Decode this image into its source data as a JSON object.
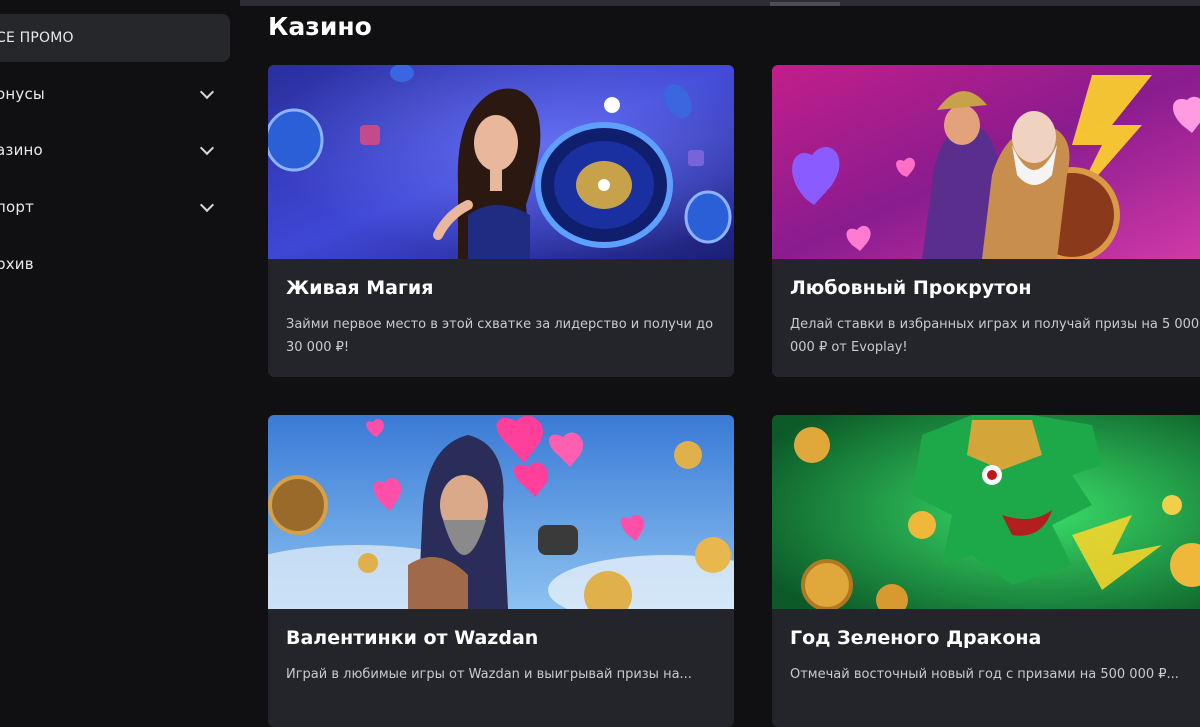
{
  "sidebar": {
    "items": [
      {
        "label": "СЕ ПРОМО",
        "active": true,
        "expandable": false
      },
      {
        "label": "онусы",
        "active": false,
        "expandable": true
      },
      {
        "label": "азино",
        "active": false,
        "expandable": true
      },
      {
        "label": "порт",
        "active": false,
        "expandable": true
      },
      {
        "label": "рхив",
        "active": false,
        "expandable": false
      }
    ]
  },
  "main": {
    "title": "Казино",
    "cards": [
      {
        "title": "Живая Магия",
        "description": "Займи первое место в этой схватке за лидерство и получи до 30 000 ₽!",
        "art": "live-roulette-artwork"
      },
      {
        "title": "Любовный Прокрутон",
        "description": "Делай ставки в избранных играх и получай призы на 5 000 000 ₽ от Evoplay!",
        "art": "zeus-warrior-artwork"
      },
      {
        "title": "Валентинки от Wazdan",
        "description": "Играй в любимые игры от Wazdan и выигрывай призы на...",
        "art": "valentine-wizard-artwork"
      },
      {
        "title": "Год Зеленого Дракона",
        "description": "Отмечай восточный новый год с призами на 500 000 ₽...",
        "art": "green-dragon-artwork"
      }
    ]
  },
  "colors": {
    "background": "#101012",
    "card": "#23252a",
    "active_item": "#26272b",
    "text": "#ffffff",
    "muted_text": "#c9cacd"
  }
}
